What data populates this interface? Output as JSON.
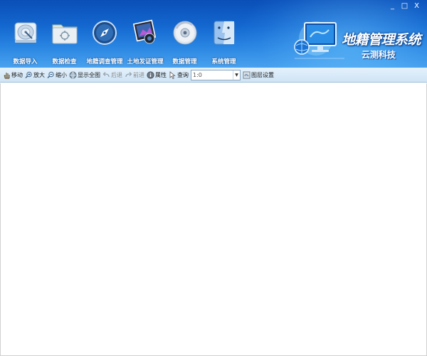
{
  "window": {
    "controls": {
      "minimize": "_",
      "maximize": "□",
      "close": "X"
    }
  },
  "modules": [
    {
      "label": "数据导入",
      "icon": "hard-drive-icon"
    },
    {
      "label": "数据检查",
      "icon": "folder-icon"
    },
    {
      "label": "地籍调查管理",
      "icon": "compass-icon"
    },
    {
      "label": "土地发证管理",
      "icon": "picture-icon"
    },
    {
      "label": "数据管理",
      "icon": "disc-icon"
    },
    {
      "label": "系统管理",
      "icon": "finder-icon"
    }
  ],
  "brand": {
    "title": "地籍管理系统",
    "subtitle": "云测科技"
  },
  "toolbar": {
    "move": "移动",
    "zoom_in": "放大",
    "zoom_out": "缩小",
    "full_extent": "显示全图",
    "back": "后退",
    "forward": "前进",
    "properties": "属性",
    "query": "查询",
    "scale": "1:0",
    "layer_settings": "图层设置"
  },
  "colors": {
    "banner": "#1367cf",
    "toolbar": "#d8eaf8"
  }
}
